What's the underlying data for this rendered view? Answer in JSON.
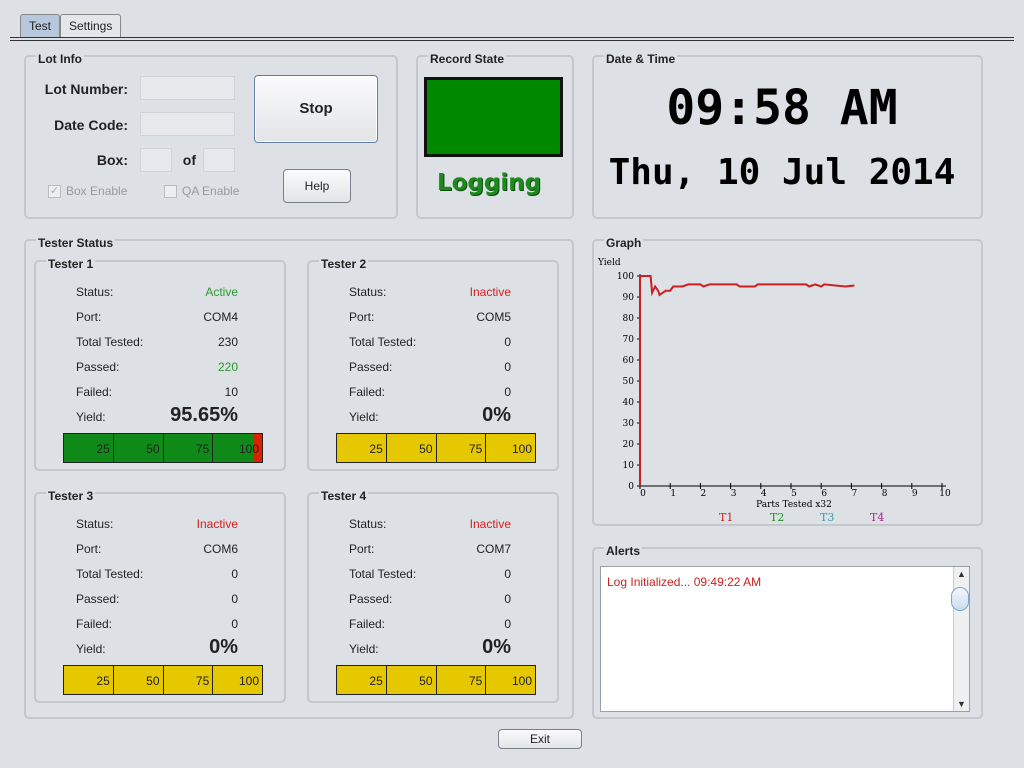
{
  "tabs": [
    {
      "label": "Test",
      "active": true
    },
    {
      "label": "Settings",
      "active": false
    }
  ],
  "lot_info": {
    "title": "Lot Info",
    "lot_number_label": "Lot Number:",
    "lot_number_value": "",
    "date_code_label": "Date Code:",
    "date_code_value": "",
    "box_label": "Box:",
    "box_of_label": "of",
    "box_value": "",
    "box_total": "",
    "box_enable_label": "Box Enable",
    "box_enable_checked": true,
    "qa_enable_label": "QA Enable",
    "qa_enable_checked": false,
    "stop_label": "Stop",
    "help_label": "Help"
  },
  "record_state": {
    "title": "Record State",
    "indicator_color": "#008800",
    "status_text": "Logging"
  },
  "datetime": {
    "title": "Date & Time",
    "time": "09:58 AM",
    "date": "Thu, 10 Jul 2014"
  },
  "tester_status": {
    "title": "Tester Status",
    "labels": {
      "status": "Status:",
      "port": "Port:",
      "total_tested": "Total Tested:",
      "passed": "Passed:",
      "failed": "Failed:",
      "yield": "Yield:"
    },
    "bar_ticks": [
      "25",
      "50",
      "75",
      "100"
    ],
    "colors": {
      "active": "#2a9a2a",
      "inactive": "#d42020",
      "pass_fill": "#0f8a18",
      "fail_fill": "#dd2200",
      "idle_fill": "#e6c800"
    },
    "testers": [
      {
        "name": "Tester 1",
        "status": "Active",
        "port": "COM4",
        "total_tested": "230",
        "passed": "220",
        "failed": "10",
        "yield": "95.65%",
        "pass_fraction": 0.9565
      },
      {
        "name": "Tester 2",
        "status": "Inactive",
        "port": "COM5",
        "total_tested": "0",
        "passed": "0",
        "failed": "0",
        "yield": "0%",
        "pass_fraction": 0
      },
      {
        "name": "Tester 3",
        "status": "Inactive",
        "port": "COM6",
        "total_tested": "0",
        "passed": "0",
        "failed": "0",
        "yield": "0%",
        "pass_fraction": 0
      },
      {
        "name": "Tester 4",
        "status": "Inactive",
        "port": "COM7",
        "total_tested": "0",
        "passed": "0",
        "failed": "0",
        "yield": "0%",
        "pass_fraction": 0
      }
    ]
  },
  "graph": {
    "title": "Graph",
    "chart_data": {
      "type": "line",
      "ylabel": "Yield",
      "xlabel": "Parts Tested x32",
      "xlim": [
        0,
        10
      ],
      "ylim": [
        0,
        100
      ],
      "x_ticks": [
        "0",
        "1",
        "2",
        "3",
        "4",
        "5",
        "6",
        "7",
        "8",
        "9",
        "10"
      ],
      "y_ticks": [
        "0",
        "10",
        "20",
        "30",
        "40",
        "50",
        "60",
        "70",
        "80",
        "90",
        "100"
      ],
      "series": [
        {
          "name": "T1",
          "color": "#cc1f1f",
          "points": [
            [
              0,
              0
            ],
            [
              0,
              100
            ],
            [
              0.35,
              100
            ],
            [
              0.4,
              92
            ],
            [
              0.5,
              95
            ],
            [
              0.6,
              93
            ],
            [
              0.65,
              91
            ],
            [
              0.85,
              93
            ],
            [
              1.0,
              93
            ],
            [
              1.1,
              95
            ],
            [
              1.4,
              95
            ],
            [
              1.6,
              96
            ],
            [
              2.0,
              96
            ],
            [
              2.1,
              95
            ],
            [
              2.3,
              96
            ],
            [
              3.2,
              96
            ],
            [
              3.3,
              95
            ],
            [
              3.8,
              95
            ],
            [
              3.9,
              96
            ],
            [
              5.5,
              96
            ],
            [
              5.6,
              95
            ],
            [
              5.8,
              96
            ],
            [
              6.0,
              95
            ],
            [
              6.1,
              96
            ],
            [
              6.8,
              95
            ],
            [
              7.1,
              95.5
            ]
          ]
        },
        {
          "name": "T2",
          "color": "#1e8e1e",
          "points": []
        },
        {
          "name": "T3",
          "color": "#2ba6a6",
          "points": []
        },
        {
          "name": "T4",
          "color": "#b01f8e",
          "points": []
        }
      ]
    }
  },
  "alerts": {
    "title": "Alerts",
    "items": [
      "Log Initialized...  09:49:22 AM"
    ]
  },
  "exit_label": "Exit"
}
